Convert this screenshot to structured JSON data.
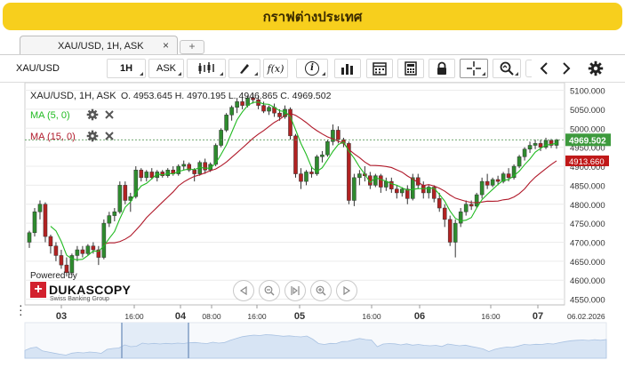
{
  "banner": {
    "title": "กราฟต่างประเทศ"
  },
  "tabs": [
    {
      "label": "XAU/USD, 1H, ASK",
      "close": "×"
    }
  ],
  "newtab": {
    "label": "+"
  },
  "toolbar": {
    "instrument": "XAU/USD",
    "period": "1H",
    "side": "ASK",
    "fx_label": "f(x)",
    "info_label": "i"
  },
  "chart_header": {
    "symbol": "XAU/USD, 1H, ASK",
    "ohlc": "O. 4953.645 H. 4970.195 L. 4946.865 C. 4969.502"
  },
  "indicators": [
    {
      "label": "MA (5, 0)",
      "color": "#22bb22"
    },
    {
      "label": "MA (15, 0)",
      "color": "#b0192a"
    }
  ],
  "colors": {
    "up": "#2e8b2e",
    "down": "#b22222",
    "ma_fast": "#22bb22",
    "ma_slow": "#b0192a",
    "price_tag": "#3d9a3d",
    "ma_tag": "#c01818"
  },
  "price_tags": {
    "current": "4969.502",
    "ma_slow": "4913.660"
  },
  "powered": {
    "line1": "Powered by",
    "brand": "DUKASCOPY",
    "tagline": "Swiss Banking Group",
    "cross": "+"
  },
  "chart_data": {
    "type": "candlestick",
    "x_ticks": [
      "03",
      "16:00",
      "04",
      "08:00",
      "16:00",
      "05",
      "16:00",
      "06",
      "16:00",
      "07",
      "06.02.2026"
    ],
    "y_ticks": [
      "5100.000",
      "5050.000",
      "5000.000",
      "4950.000",
      "4900.000",
      "4850.000",
      "4800.000",
      "4750.000",
      "4700.000",
      "4650.000",
      "4600.000",
      "4550.000"
    ],
    "ylim": [
      4535,
      5120
    ],
    "grid": true,
    "candles": [
      [
        4700,
        4730,
        4685,
        4725
      ],
      [
        4725,
        4790,
        4715,
        4780
      ],
      [
        4780,
        4810,
        4760,
        4800
      ],
      [
        4800,
        4805,
        4700,
        4715
      ],
      [
        4715,
        4720,
        4670,
        4690
      ],
      [
        4690,
        4700,
        4650,
        4665
      ],
      [
        4665,
        4680,
        4630,
        4640
      ],
      [
        4640,
        4660,
        4610,
        4620
      ],
      [
        4620,
        4670,
        4615,
        4665
      ],
      [
        4665,
        4690,
        4650,
        4680
      ],
      [
        4680,
        4690,
        4660,
        4670
      ],
      [
        4670,
        4695,
        4665,
        4690
      ],
      [
        4690,
        4700,
        4670,
        4680
      ],
      [
        4680,
        4690,
        4640,
        4660
      ],
      [
        4660,
        4760,
        4655,
        4750
      ],
      [
        4750,
        4780,
        4740,
        4770
      ],
      [
        4770,
        4790,
        4755,
        4780
      ],
      [
        4780,
        4860,
        4775,
        4850
      ],
      [
        4850,
        4860,
        4800,
        4810
      ],
      [
        4810,
        4830,
        4780,
        4820
      ],
      [
        4820,
        4900,
        4815,
        4890
      ],
      [
        4890,
        4895,
        4860,
        4870
      ],
      [
        4870,
        4890,
        4860,
        4885
      ],
      [
        4885,
        4895,
        4865,
        4870
      ],
      [
        4870,
        4890,
        4860,
        4885
      ],
      [
        4885,
        4890,
        4870,
        4875
      ],
      [
        4875,
        4895,
        4870,
        4890
      ],
      [
        4890,
        4900,
        4875,
        4880
      ],
      [
        4880,
        4905,
        4875,
        4900
      ],
      [
        4900,
        4915,
        4890,
        4905
      ],
      [
        4905,
        4910,
        4885,
        4890
      ],
      [
        4890,
        4895,
        4860,
        4880
      ],
      [
        4880,
        4915,
        4875,
        4910
      ],
      [
        4910,
        4920,
        4880,
        4890
      ],
      [
        4890,
        4910,
        4885,
        4905
      ],
      [
        4905,
        4960,
        4900,
        4955
      ],
      [
        4955,
        5000,
        4950,
        4995
      ],
      [
        4995,
        5040,
        4990,
        5035
      ],
      [
        5035,
        5060,
        5020,
        5055
      ],
      [
        5055,
        5080,
        5040,
        5070
      ],
      [
        5070,
        5080,
        5050,
        5060
      ],
      [
        5060,
        5085,
        5055,
        5080
      ],
      [
        5080,
        5090,
        5065,
        5075
      ],
      [
        5075,
        5085,
        5050,
        5060
      ],
      [
        5060,
        5070,
        5040,
        5045
      ],
      [
        5045,
        5060,
        5035,
        5055
      ],
      [
        5055,
        5065,
        5030,
        5040
      ],
      [
        5040,
        5050,
        5020,
        5030
      ],
      [
        5030,
        5060,
        5025,
        5050
      ],
      [
        5050,
        5055,
        4970,
        4980
      ],
      [
        4980,
        4985,
        4870,
        4880
      ],
      [
        4880,
        4895,
        4840,
        4860
      ],
      [
        4860,
        4890,
        4850,
        4885
      ],
      [
        4885,
        4900,
        4870,
        4880
      ],
      [
        4880,
        4930,
        4875,
        4925
      ],
      [
        4925,
        4940,
        4910,
        4930
      ],
      [
        4930,
        4970,
        4925,
        4965
      ],
      [
        4965,
        5010,
        4955,
        4995
      ],
      [
        4995,
        5005,
        4960,
        4970
      ],
      [
        4970,
        4975,
        4950,
        4960
      ],
      [
        4960,
        4965,
        4800,
        4810
      ],
      [
        4810,
        4880,
        4795,
        4870
      ],
      [
        4870,
        4890,
        4850,
        4880
      ],
      [
        4880,
        4900,
        4860,
        4875
      ],
      [
        4875,
        4885,
        4840,
        4850
      ],
      [
        4850,
        4880,
        4845,
        4875
      ],
      [
        4875,
        4880,
        4830,
        4845
      ],
      [
        4845,
        4870,
        4835,
        4860
      ],
      [
        4860,
        4870,
        4830,
        4840
      ],
      [
        4840,
        4850,
        4815,
        4830
      ],
      [
        4830,
        4845,
        4820,
        4840
      ],
      [
        4840,
        4850,
        4800,
        4815
      ],
      [
        4815,
        4880,
        4810,
        4870
      ],
      [
        4870,
        4880,
        4840,
        4850
      ],
      [
        4850,
        4860,
        4815,
        4830
      ],
      [
        4830,
        4850,
        4815,
        4845
      ],
      [
        4845,
        4850,
        4805,
        4815
      ],
      [
        4815,
        4830,
        4780,
        4790
      ],
      [
        4790,
        4800,
        4740,
        4760
      ],
      [
        4760,
        4770,
        4690,
        4700
      ],
      [
        4700,
        4760,
        4660,
        4750
      ],
      [
        4750,
        4790,
        4740,
        4780
      ],
      [
        4780,
        4810,
        4770,
        4800
      ],
      [
        4800,
        4810,
        4785,
        4795
      ],
      [
        4795,
        4830,
        4790,
        4825
      ],
      [
        4825,
        4870,
        4815,
        4860
      ],
      [
        4860,
        4880,
        4840,
        4850
      ],
      [
        4850,
        4870,
        4845,
        4865
      ],
      [
        4865,
        4875,
        4850,
        4860
      ],
      [
        4860,
        4885,
        4855,
        4880
      ],
      [
        4880,
        4895,
        4860,
        4870
      ],
      [
        4870,
        4905,
        4865,
        4900
      ],
      [
        4900,
        4930,
        4895,
        4925
      ],
      [
        4925,
        4950,
        4915,
        4945
      ],
      [
        4945,
        4965,
        4935,
        4955
      ],
      [
        4955,
        4970,
        4945,
        4960
      ],
      [
        4960,
        4970,
        4940,
        4950
      ],
      [
        4950,
        4975,
        4945,
        4968
      ],
      [
        4968,
        4972,
        4948,
        4955
      ],
      [
        4955,
        4972,
        4946,
        4969.5
      ]
    ]
  }
}
